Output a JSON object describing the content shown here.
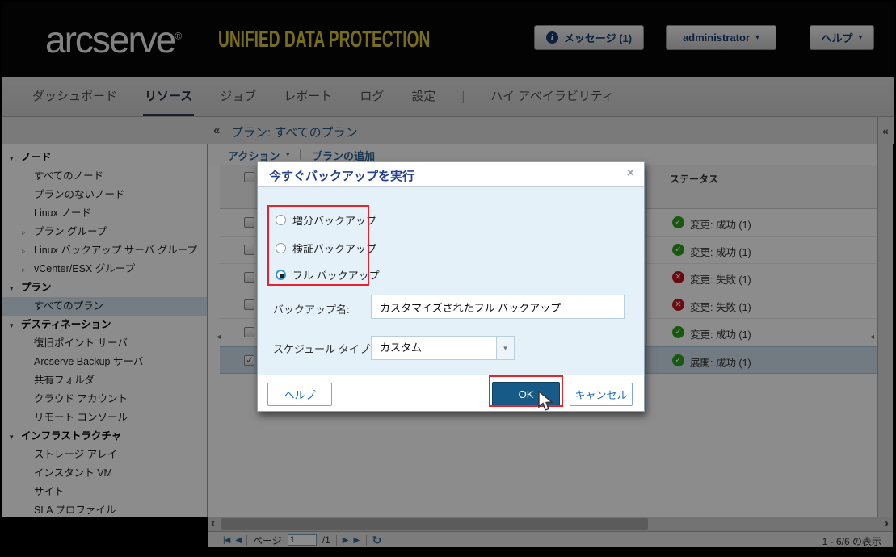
{
  "header": {
    "logo": "arcserve",
    "registered": "®",
    "product": "UNIFIED DATA PROTECTION",
    "messages_button": "メッセージ (1)",
    "user_button": "administrator",
    "help_button": "ヘルプ"
  },
  "nav": {
    "tabs": [
      "ダッシュボード",
      "リソース",
      "ジョブ",
      "レポート",
      "ログ",
      "設定"
    ],
    "active_tab": "リソース",
    "divider": "|",
    "ha_tab": "ハイ アベイラビリティ"
  },
  "sidebar": {
    "sections": [
      {
        "label": "ノード",
        "items": [
          "すべてのノード",
          "プランのないノード",
          "Linux ノード",
          "プラン グループ",
          "Linux バックアップ サーバ グループ",
          "vCenter/ESX グループ"
        ]
      },
      {
        "label": "プラン",
        "items": [
          "すべてのプラン"
        ]
      },
      {
        "label": "デスティネーション",
        "items": [
          "復旧ポイント サーバ",
          "Arcserve Backup サーバ",
          "共有フォルダ",
          "クラウド アカウント",
          "リモート コンソール"
        ]
      },
      {
        "label": "インフラストラクチャ",
        "items": [
          "ストレージ アレイ",
          "インスタント VM",
          "サイト",
          "SLA プロファイル"
        ]
      }
    ],
    "selected_item": "すべてのプラン"
  },
  "main": {
    "title": "プラン: すべてのプラン",
    "toolbar": {
      "actions": "アクション",
      "separator": "|",
      "add_plan": "プランの追加"
    },
    "table": {
      "status_header": "ステータス",
      "rows": [
        {
          "status": "変更: 成功 (1)",
          "state": "success",
          "checked": false
        },
        {
          "status": "変更: 成功 (1)",
          "state": "success",
          "checked": false
        },
        {
          "status": "変更: 失敗 (1)",
          "state": "error",
          "checked": false
        },
        {
          "status": "変更: 失敗 (1)",
          "state": "error",
          "checked": false
        },
        {
          "status": "変更: 成功 (1)",
          "state": "success",
          "checked": false
        },
        {
          "status": "展開: 成功 (1)",
          "state": "success",
          "checked": true,
          "selected": true
        }
      ]
    },
    "pager": {
      "page_label": "ページ",
      "page_value": "1",
      "page_total": "/1",
      "range": "1 - 6/6 の表示"
    }
  },
  "dialog": {
    "title": "今すぐバックアップを実行",
    "radios": [
      "増分バックアップ",
      "検証バックアップ",
      "フル バックアップ"
    ],
    "selected_radio": "フル バックアップ",
    "backup_name_label": "バックアップ名:",
    "backup_name_value": "カスタマイズされたフル バックアップ",
    "schedule_label": "スケジュール タイプ",
    "schedule_value": "カスタム",
    "help_button": "ヘルプ",
    "ok_button": "OK",
    "cancel_button": "キャンセル"
  },
  "icons": {
    "info": "i",
    "caret": "▾",
    "collapse": "«",
    "tree_expanded": "▾",
    "tree_collapsed": "▹",
    "success": "✓",
    "error": "✕",
    "check": "✓",
    "pager_first": "|◀",
    "pager_prev": "◀",
    "pager_next": "▶",
    "pager_last": "▶|",
    "refresh": "↻",
    "scroll_left": "‹",
    "scroll_right": "›",
    "dropdown": "▾",
    "splitter": "◂",
    "close": "×"
  },
  "colors": {
    "accent_blue": "#175a88",
    "link_blue": "#2a6496",
    "annotation_red": "#e8232d",
    "success_green": "#2ca01c",
    "error_red": "#c2131c",
    "brand_yellow": "#d9c630",
    "dialog_body": "#e4f1f8"
  }
}
